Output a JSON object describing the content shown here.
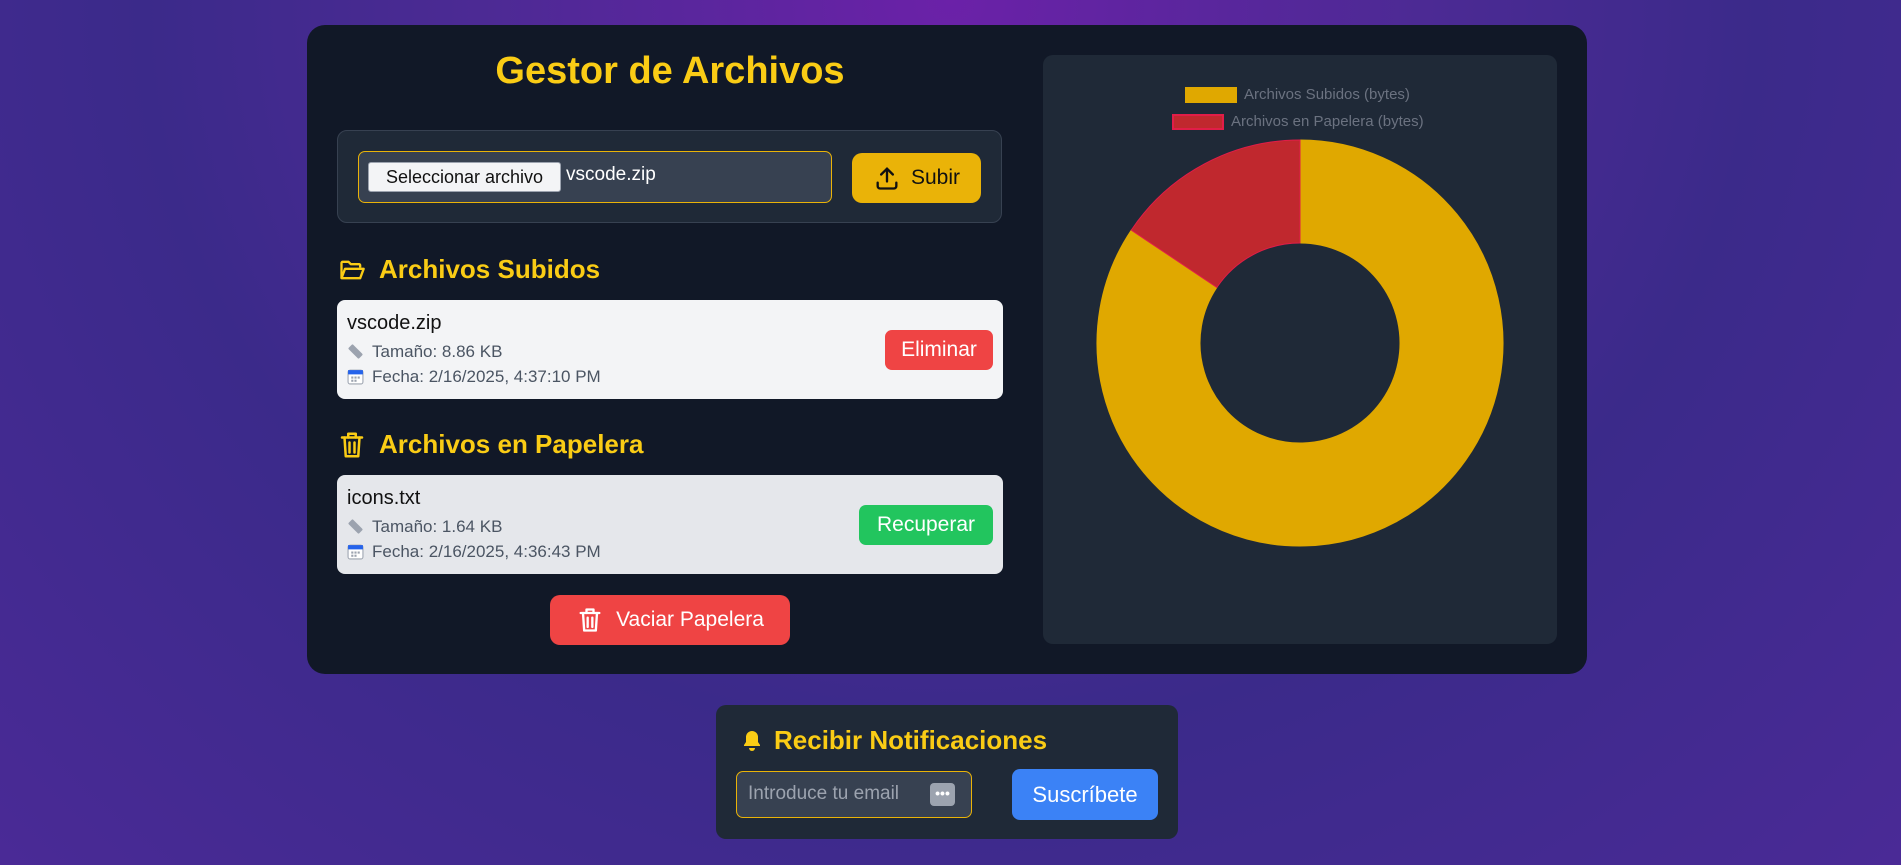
{
  "app": {
    "title": "Gestor de Archivos"
  },
  "upload": {
    "choose_label": "Seleccionar archivo",
    "selected_file": "vscode.zip",
    "upload_label": "Subir"
  },
  "uploaded": {
    "heading": "Archivos Subidos",
    "files": [
      {
        "name": "vscode.zip",
        "size": "Tamaño: 8.86 KB",
        "date": "Fecha: 2/16/2025, 4:37:10 PM",
        "action": "Eliminar"
      }
    ]
  },
  "trash": {
    "heading": "Archivos en Papelera",
    "files": [
      {
        "name": "icons.txt",
        "size": "Tamaño: 1.64 KB",
        "date": "Fecha: 2/16/2025, 4:36:43 PM",
        "action": "Recuperar"
      }
    ],
    "empty_label": "Vaciar Papelera"
  },
  "chart_data": {
    "type": "pie",
    "donut": true,
    "categories": [
      "Archivos Subidos (bytes)",
      "Archivos en Papelera (bytes)"
    ],
    "values": [
      9073,
      1679
    ],
    "colors": [
      "#e0a800",
      "#c0282e"
    ],
    "legend": "top"
  },
  "notifications": {
    "title": "Recibir Notificaciones",
    "email_placeholder": "Introduce tu email",
    "subscribe_label": "Suscríbete"
  },
  "colors": {
    "accent": "#facc15",
    "danger": "#ef4444",
    "success": "#22c55e",
    "primary": "#3b82f6"
  }
}
